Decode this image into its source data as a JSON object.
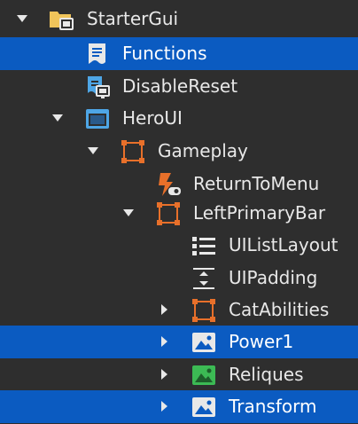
{
  "explorer": {
    "items": [
      {
        "name": "StarterGui",
        "icon": "folder-gui-icon",
        "expanded": true
      },
      {
        "name": "Functions",
        "icon": "module-script-icon",
        "selected": true
      },
      {
        "name": "DisableReset",
        "icon": "local-script-icon"
      },
      {
        "name": "HeroUI",
        "icon": "screen-gui-icon",
        "expanded": true
      },
      {
        "name": "Gameplay",
        "icon": "frame-icon",
        "expanded": true
      },
      {
        "name": "ReturnToMenu",
        "icon": "local-script-disabled-icon"
      },
      {
        "name": "LeftPrimaryBar",
        "icon": "frame-icon",
        "expanded": true
      },
      {
        "name": "UIListLayout",
        "icon": "list-layout-icon"
      },
      {
        "name": "UIPadding",
        "icon": "padding-icon"
      },
      {
        "name": "CatAbilities",
        "icon": "frame-icon",
        "expanded": false
      },
      {
        "name": "Power1",
        "icon": "image-label-icon",
        "expanded": false,
        "selected": true
      },
      {
        "name": "Reliques",
        "icon": "image-button-icon",
        "expanded": false
      },
      {
        "name": "Transform",
        "icon": "image-label-icon",
        "expanded": false,
        "selected": true
      }
    ]
  },
  "colors": {
    "background": "#2e2e2e",
    "selection": "#0b5bc1",
    "text": "#e8e8e8",
    "frame_orange": "#e8702a",
    "script_blue": "#4ea6e6",
    "image_button_green": "#3cba54",
    "folder_yellow": "#f0c45a"
  }
}
